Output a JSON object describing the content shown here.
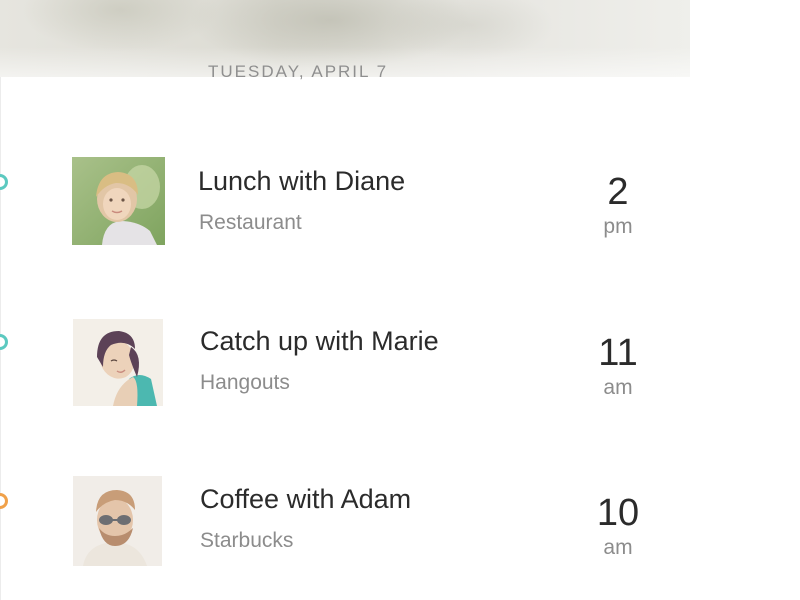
{
  "header": {
    "date": "TUESDAY, APRIL 7"
  },
  "events": [
    {
      "title": "Lunch with Diane",
      "location": "Restaurant",
      "time": "2",
      "ampm": "pm",
      "avatar": "woman-blonde-avatar",
      "dot_color": "#5cc9c0"
    },
    {
      "title": "Catch up with Marie",
      "location": "Hangouts",
      "time": "11",
      "ampm": "am",
      "avatar": "woman-dark-hair-avatar",
      "dot_color": "#5cc9c0"
    },
    {
      "title": "Coffee with Adam",
      "location": "Starbucks",
      "time": "10",
      "ampm": "am",
      "avatar": "man-sunglasses-avatar",
      "dot_color": "#f0a14a"
    }
  ]
}
